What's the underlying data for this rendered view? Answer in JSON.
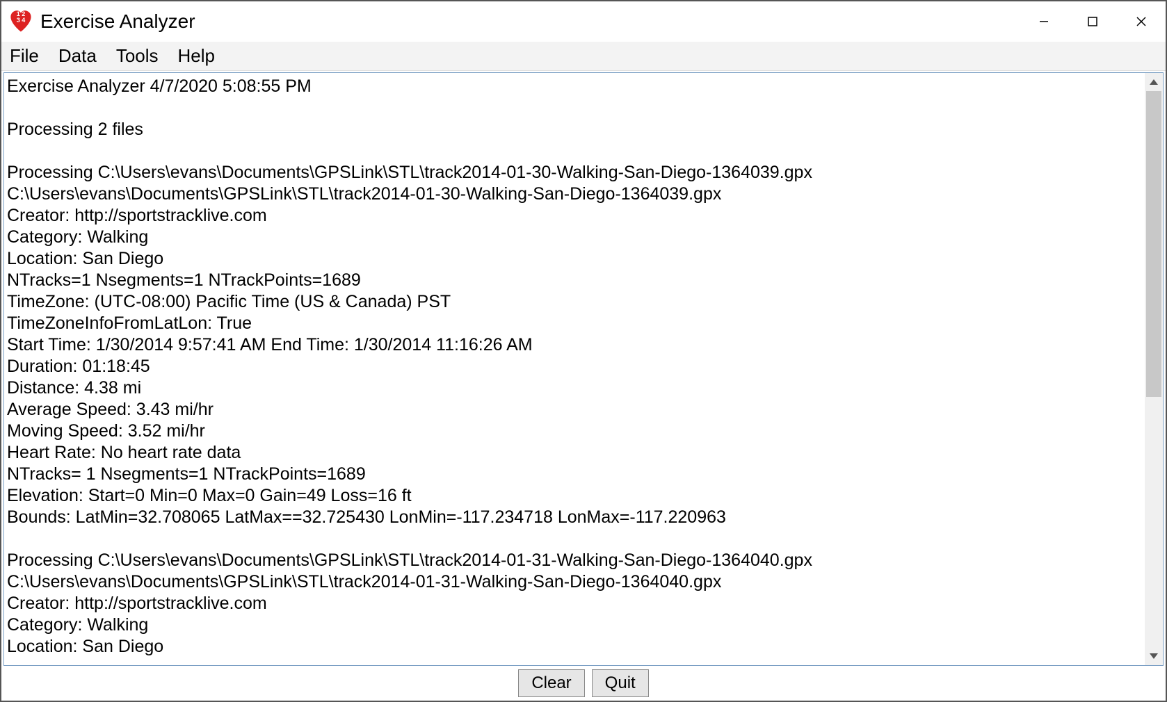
{
  "window": {
    "title": "Exercise Analyzer",
    "icon_numbers": "1 2\n3 4"
  },
  "menu": {
    "file": "File",
    "data": "Data",
    "tools": "Tools",
    "help": "Help"
  },
  "output": {
    "lines": [
      "Exercise Analyzer 4/7/2020 5:08:55 PM",
      "",
      "Processing 2 files",
      "",
      "Processing C:\\Users\\evans\\Documents\\GPSLink\\STL\\track2014-01-30-Walking-San-Diego-1364039.gpx",
      "C:\\Users\\evans\\Documents\\GPSLink\\STL\\track2014-01-30-Walking-San-Diego-1364039.gpx",
      "Creator: http://sportstracklive.com",
      "Category: Walking",
      "Location: San Diego",
      "NTracks=1 Nsegments=1 NTrackPoints=1689",
      "TimeZone: (UTC-08:00) Pacific Time (US & Canada) PST",
      "TimeZoneInfoFromLatLon: True",
      "Start Time: 1/30/2014 9:57:41 AM End Time: 1/30/2014 11:16:26 AM",
      "Duration: 01:18:45",
      "Distance: 4.38 mi",
      "Average Speed: 3.43 mi/hr",
      "Moving Speed: 3.52 mi/hr",
      "Heart Rate: No heart rate data",
      "NTracks= 1 Nsegments=1 NTrackPoints=1689",
      "Elevation: Start=0 Min=0 Max=0 Gain=49 Loss=16 ft",
      "Bounds: LatMin=32.708065 LatMax==32.725430 LonMin=-117.234718 LonMax=-117.220963",
      "",
      "Processing C:\\Users\\evans\\Documents\\GPSLink\\STL\\track2014-01-31-Walking-San-Diego-1364040.gpx",
      "C:\\Users\\evans\\Documents\\GPSLink\\STL\\track2014-01-31-Walking-San-Diego-1364040.gpx",
      "Creator: http://sportstracklive.com",
      "Category: Walking",
      "Location: San Diego"
    ]
  },
  "buttons": {
    "clear": "Clear",
    "quit": "Quit"
  }
}
